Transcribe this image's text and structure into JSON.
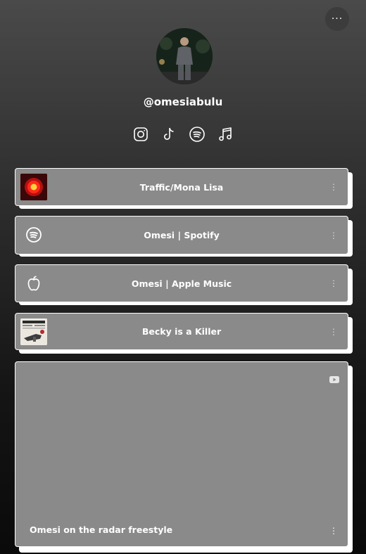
{
  "profile": {
    "handle": "@omesiabulu",
    "more_label": "···"
  },
  "socials": [
    {
      "icon": "instagram-icon"
    },
    {
      "icon": "tiktok-icon"
    },
    {
      "icon": "spotify-icon"
    },
    {
      "icon": "music-note-icon"
    }
  ],
  "links": [
    {
      "label": "Traffic/Mona Lisa",
      "thumb": "red-traffic-light-artwork"
    },
    {
      "label": "Omesi | Spotify",
      "thumb": "spotify-icon"
    },
    {
      "label": "Omesi | Apple Music",
      "thumb": "apple-icon"
    },
    {
      "label": "Becky is a Killer",
      "thumb": "newspaper-artwork"
    }
  ],
  "video": {
    "label": "Omesi on the radar freestyle",
    "icon": "youtube-icon"
  },
  "menu_glyph": "⋮",
  "colors": {
    "card_bg": "#8a8a8a",
    "card_shadow": "#ffffff",
    "page_top": "#4a4a4a",
    "page_bottom": "#0a0a0a"
  }
}
